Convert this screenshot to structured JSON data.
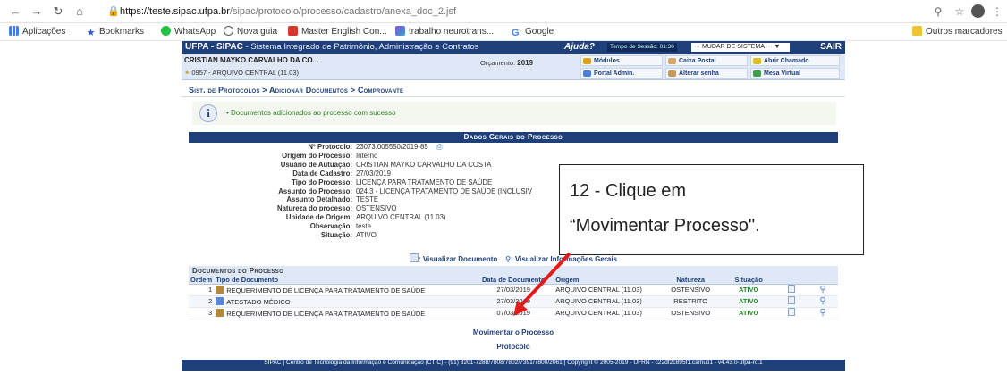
{
  "browser": {
    "url_host": "https://teste.sipac.ufpa.br",
    "url_path": "/sipac/protocolo/processo/cadastro/anexa_doc_2.jsf",
    "bookmarks": [
      "Aplicações",
      "Bookmarks",
      "WhatsApp",
      "Nova guia",
      "Master English Con...",
      "trabalho neurotrans...",
      "Google"
    ],
    "other_bookmarks": "Outros marcadores"
  },
  "sipac": {
    "title": "UFPA - SIPAC",
    "subtitle": "- Sistema Integrado de Patrimônio, Administração e Contratos",
    "help": "Ajuda?",
    "session": "Tempo de Sessão: 01:30",
    "change_system": "--- MUDAR DE SISTEMA --- ▼",
    "exit": "SAIR",
    "user": "CRISTIAN MAYKO CARVALHO DA CO...",
    "unit": "0957 - ARQUIVO CENTRAL (11.03)",
    "budget_label": "Orçamento:",
    "budget_year": "2019",
    "modules": [
      "Módulos",
      "Caixa Postal",
      "Abrir Chamado",
      "Portal Admin.",
      "Alterar senha",
      "Mesa Virtual"
    ],
    "breadcrumb": "Sist. de Protocolos > Adicionar Documentos > Comprovante",
    "success_msg": "• Documentos adicionados ao processo com sucesso",
    "section_title": "Dados Gerais do Processo",
    "fields": [
      {
        "label": "Nº Protocolo:",
        "value": "23073.005550/2019-85"
      },
      {
        "label": "Origem do Processo:",
        "value": "Interno"
      },
      {
        "label": "Usuário de Autuação:",
        "value": "CRISTIAN MAYKO CARVALHO DA COSTA"
      },
      {
        "label": "Data de Cadastro:",
        "value": "27/03/2019"
      },
      {
        "label": "Tipo do Processo:",
        "value": "LICENÇA PARA TRATAMENTO DE SAÚDE"
      },
      {
        "label": "Assunto do Processo:",
        "value": "024.3 - LICENÇA TRATAMENTO DE SAÚDE (INCLUSIV"
      },
      {
        "label": "Assunto Detalhado:",
        "value": "TESTE"
      },
      {
        "label": "Natureza do processo:",
        "value": "OSTENSIVO"
      },
      {
        "label": "Unidade de Origem:",
        "value": "ARQUIVO CENTRAL (11.03)"
      },
      {
        "label": "Observação:",
        "value": "teste"
      },
      {
        "label": "Situação:",
        "value": "ATIVO"
      }
    ],
    "view_doc": ": Visualizar Documento",
    "view_info": ": Visualizar Informações Gerais",
    "docs_title": "Documentos do Processo",
    "columns": [
      "Ordem",
      "Tipo de Documento",
      "Data de Documento",
      "Origem",
      "Natureza",
      "Situação"
    ],
    "rows": [
      {
        "ordem": "1",
        "tipo": "REQUERIMENTO DE LICENÇA PARA TRATAMENTO DE SAÚDE",
        "data": "27/03/2019",
        "origem": "ARQUIVO CENTRAL (11.03)",
        "natureza": "OSTENSIVO",
        "situacao": "ATIVO"
      },
      {
        "ordem": "2",
        "tipo": "ATESTADO MÉDICO",
        "data": "27/03/2019",
        "origem": "ARQUIVO CENTRAL (11.03)",
        "natureza": "RESTRITO",
        "situacao": "ATIVO"
      },
      {
        "ordem": "3",
        "tipo": "REQUERIMENTO DE LICENÇA PARA TRATAMENTO DE SAÚDE",
        "data": "07/03/2019",
        "origem": "ARQUIVO CENTRAL (11.03)",
        "natureza": "OSTENSIVO",
        "situacao": "ATIVO"
      }
    ],
    "move_link": "Movimentar o Processo",
    "protocol_link": "Protocolo",
    "footer": "SIPAC | Centro de Tecnologia da Informação e Comunicação (CTIC) - (91) 3201-7288/7808/7802/7391/7800/2061 | Copyright © 2005-2019 - UFRN - c22df2c895f1.camuti1 - v4.43.0-ufpa-rc.1"
  },
  "callout": {
    "line1": "12 - Clique em",
    "line2": "“Movimentar Processo\"."
  },
  "colors": {
    "brand": "#1f3f7a",
    "success": "#2f7d1f",
    "arrow": "#e21b1b"
  }
}
